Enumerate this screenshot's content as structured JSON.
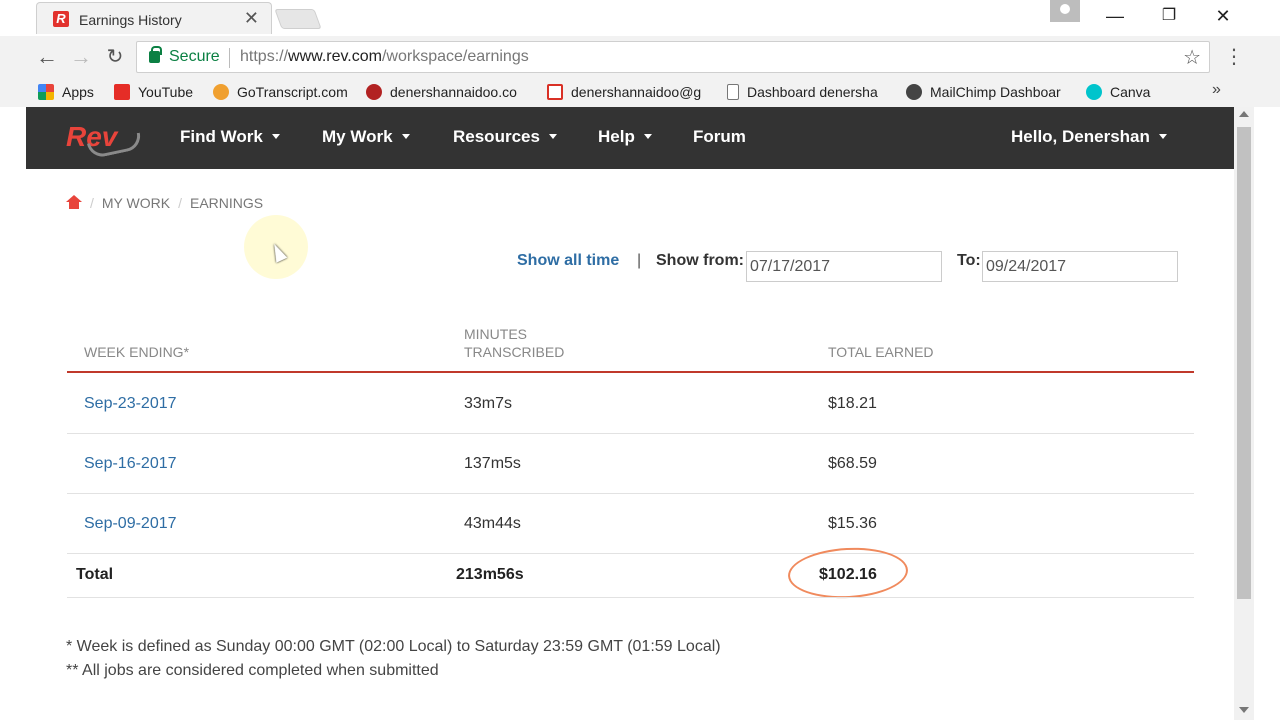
{
  "browser": {
    "tab_title": "Earnings History",
    "tab_favicon": "R",
    "secure_label": "Secure",
    "url_prefix": "https://",
    "url_host": "www.rev.com",
    "url_path": "/workspace/earnings",
    "bookmarks": [
      {
        "label": "Apps",
        "icon": "apps-grid-icon",
        "color": "#e8443b"
      },
      {
        "label": "YouTube",
        "icon": "youtube-icon",
        "color": "#e52d27"
      },
      {
        "label": "GoTranscript.com",
        "icon": "gotranscript-icon",
        "color": "#f0a030"
      },
      {
        "label": "denershannaidoo.co",
        "icon": "site-icon",
        "color": "#b22222"
      },
      {
        "label": "denershannaidoo@g",
        "icon": "gmail-icon",
        "color": "#d93025"
      },
      {
        "label": "Dashboard denersha",
        "icon": "page-icon",
        "color": "#ffffff"
      },
      {
        "label": "MailChimp Dashboar",
        "icon": "mailchimp-icon",
        "color": "#444444"
      },
      {
        "label": "Canva",
        "icon": "canva-icon",
        "color": "#00c4cc"
      }
    ]
  },
  "site": {
    "logo": "Rev",
    "nav": [
      "Find Work",
      "My Work",
      "Resources",
      "Help",
      "Forum"
    ],
    "greeting": "Hello, Denershan"
  },
  "breadcrumb": [
    "MY WORK",
    "EARNINGS"
  ],
  "filter": {
    "show_all": "Show all time",
    "separator": "|",
    "from_label": "Show from:",
    "from_value": "07/17/2017",
    "to_label": "To:",
    "to_value": "09/24/2017"
  },
  "table": {
    "headers": [
      "WEEK ENDING*",
      "MINUTES",
      "TRANSCRIBED",
      "TOTAL EARNED"
    ],
    "rows": [
      {
        "week": "Sep-23-2017",
        "minutes": "33m7s",
        "earned": "$18.21"
      },
      {
        "week": "Sep-16-2017",
        "minutes": "137m5s",
        "earned": "$68.59"
      },
      {
        "week": "Sep-09-2017",
        "minutes": "43m44s",
        "earned": "$15.36"
      }
    ],
    "total": {
      "label": "Total",
      "minutes": "213m56s",
      "earned": "$102.16"
    }
  },
  "notes": [
    "* Week is defined as Sunday 00:00 GMT (02:00 Local) to Saturday 23:59 GMT (01:59 Local)",
    "** All jobs are considered completed when submitted"
  ],
  "colors": {
    "nav_bg": "#333333",
    "brand_red": "#e8443b",
    "link_blue": "#2e6da4",
    "header_rule": "#c0392b",
    "annotation_circle": "#f08a5d"
  }
}
